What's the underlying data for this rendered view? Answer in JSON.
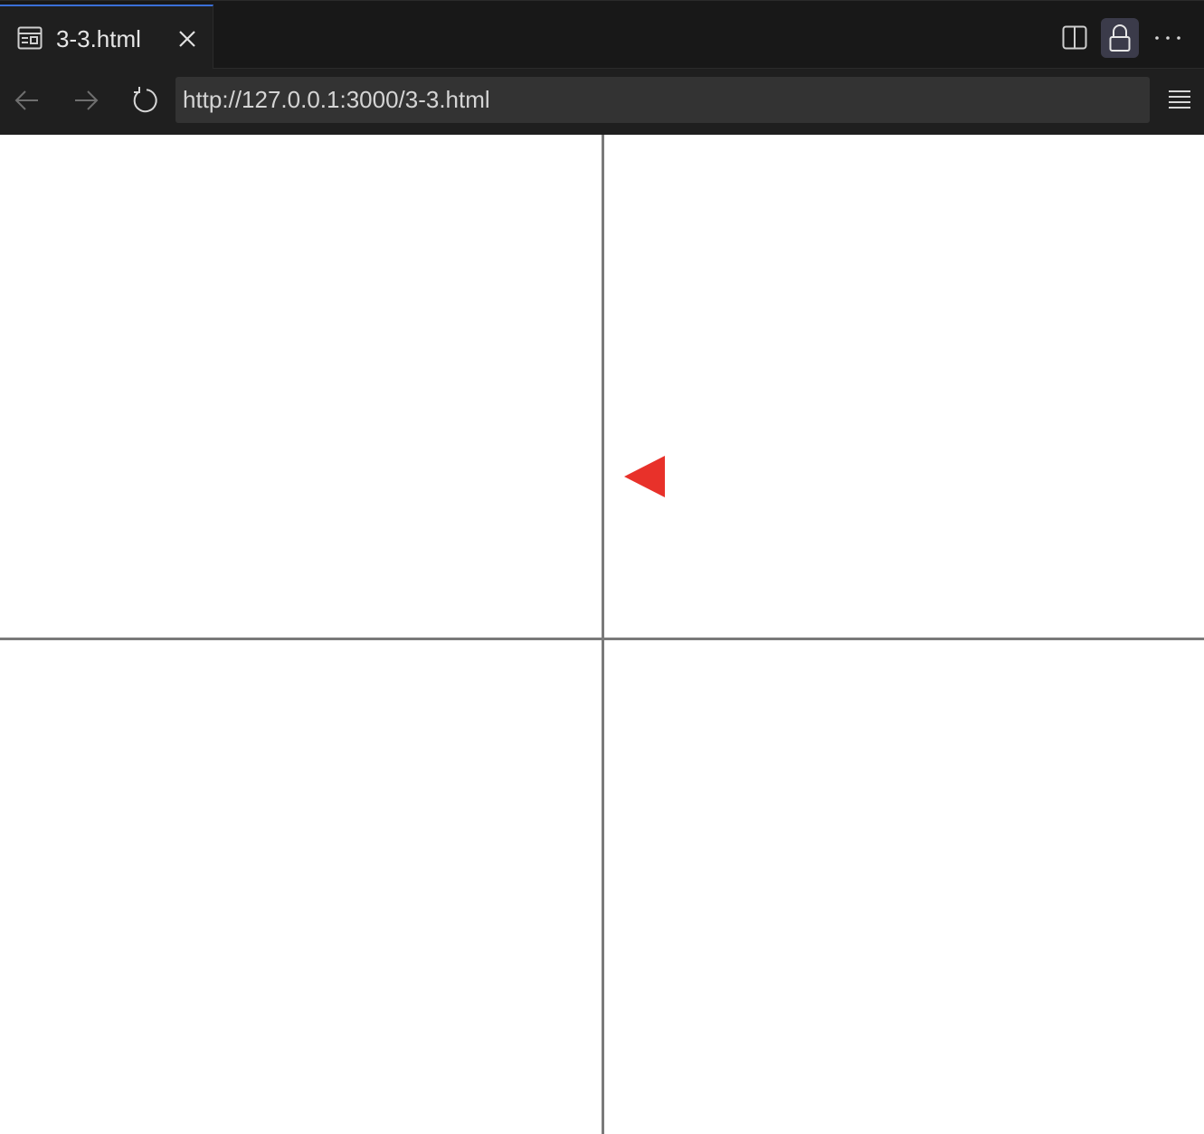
{
  "tab": {
    "title": "3-3.html",
    "icon": "page-preview-icon",
    "close_icon": "close-icon"
  },
  "toolbar": {
    "split_icon": "split-editor-icon",
    "lock_icon": "lock-icon",
    "more_icon": "more-actions-icon"
  },
  "nav": {
    "back_icon": "arrow-left-icon",
    "forward_icon": "arrow-right-icon",
    "reload_icon": "reload-icon",
    "url": "http://127.0.0.1:3000/3-3.html",
    "menu_icon": "hamburger-menu-icon"
  },
  "content": {
    "background_color": "#ffffff",
    "axis_color": "#7a7a7a",
    "marker_color": "#e8312a",
    "marker_shape": "triangle-pointing-left"
  }
}
